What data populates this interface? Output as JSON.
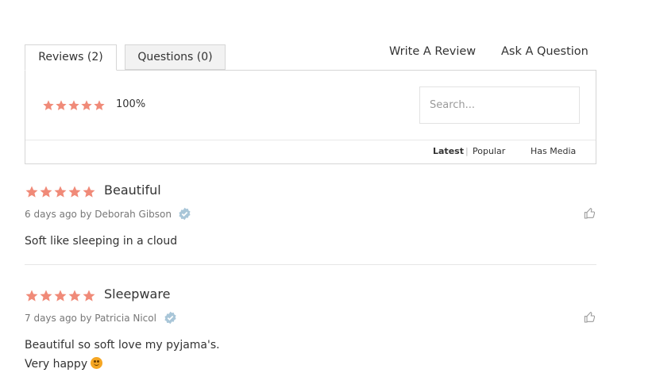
{
  "tabs": {
    "reviews_label": "Reviews (2)",
    "questions_label": "Questions (0)"
  },
  "actions": {
    "write_review": "Write A Review",
    "ask_question": "Ask A Question"
  },
  "summary": {
    "rating": 5,
    "max_rating": 5,
    "percent": "100%"
  },
  "search": {
    "placeholder": "Search...",
    "value": ""
  },
  "sort": {
    "latest": "Latest",
    "separator": "|",
    "popular": "Popular",
    "has_media": "Has Media",
    "active": "Latest"
  },
  "colors": {
    "star": "#f08a78",
    "verified": "#a9c6d8",
    "thumb": "#9a9a9a"
  },
  "reviews": [
    {
      "rating": 5,
      "title": "Beautiful",
      "meta": "6 days ago by Deborah Gibson",
      "verified_icon": "verified-badge-icon",
      "body_lines": [
        "Soft like sleeping in a cloud"
      ]
    },
    {
      "rating": 5,
      "title": "Sleepware",
      "meta": "7 days ago by Patricia Nicol",
      "verified_icon": "verified-badge-icon",
      "body_lines": [
        "Beautiful so soft love my pyjama's.",
        "Very happy"
      ],
      "emoji_icon": "smiling-face-emoji"
    }
  ]
}
